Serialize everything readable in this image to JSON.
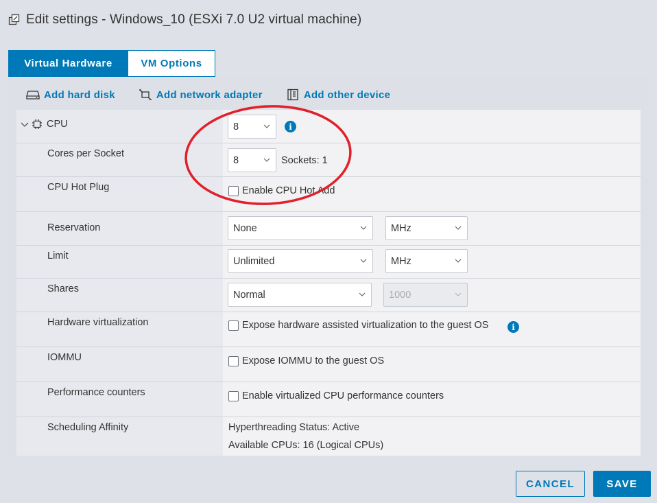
{
  "dialog": {
    "title": "Edit settings - Windows_10 (ESXi 7.0 U2 virtual machine)",
    "title_icon": "edit-settings-icon"
  },
  "tabs": [
    {
      "label": "Virtual Hardware",
      "active": true
    },
    {
      "label": "VM Options",
      "active": false
    }
  ],
  "actions": {
    "add_hard_disk": "Add hard disk",
    "add_network_adapter": "Add network adapter",
    "add_other_device": "Add other device"
  },
  "cpu": {
    "section_label": "CPU",
    "cpu_count": "8",
    "cores_per_socket_label": "Cores per Socket",
    "cores_per_socket": "8",
    "sockets_text": "Sockets: 1",
    "hot_plug_label": "CPU Hot Plug",
    "hot_plug_checkbox": "Enable CPU Hot Add",
    "hot_plug_checked": false,
    "reservation_label": "Reservation",
    "reservation_value": "None",
    "reservation_unit": "MHz",
    "limit_label": "Limit",
    "limit_value": "Unlimited",
    "limit_unit": "MHz",
    "shares_label": "Shares",
    "shares_value": "Normal",
    "shares_number": "1000",
    "hw_virt_label": "Hardware virtualization",
    "hw_virt_checkbox": "Expose hardware assisted virtualization to the guest OS",
    "hw_virt_checked": false,
    "iommu_label": "IOMMU",
    "iommu_checkbox": "Expose IOMMU to the guest OS",
    "iommu_checked": false,
    "perf_label": "Performance counters",
    "perf_checkbox": "Enable virtualized CPU performance counters",
    "perf_checked": false,
    "affinity_label": "Scheduling Affinity",
    "hyperthreading_status": "Hyperthreading Status: Active",
    "available_cpus": "Available CPUs: 16 (Logical CPUs)"
  },
  "footer": {
    "cancel_label": "CANCEL",
    "save_label": "SAVE"
  },
  "colors": {
    "accent": "#0079b8",
    "annotation": "#e0202a"
  }
}
